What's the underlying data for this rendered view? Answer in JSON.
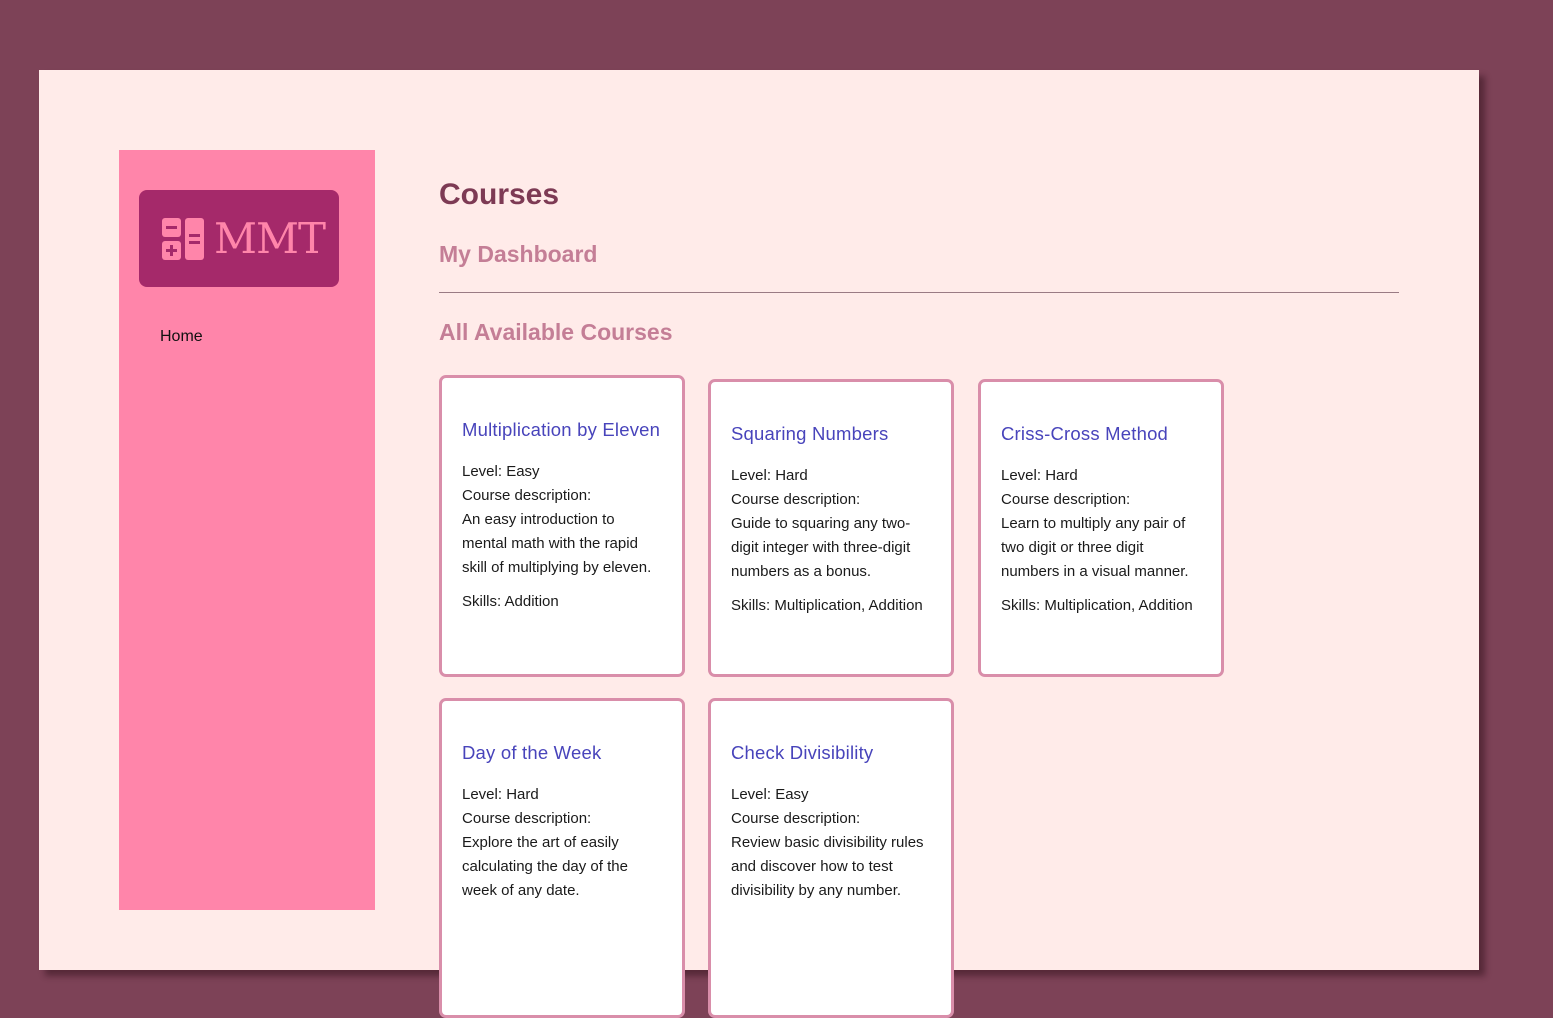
{
  "brand": {
    "logo_text": "MMT",
    "logo_icon": "calculator-icon",
    "colors": {
      "background": "#7d4257",
      "page": "#ffebe9",
      "sidebar": "#ff85aa",
      "logo_bg": "#a5296a",
      "title": "#7d3a54",
      "section": "#c47e96",
      "card_title": "#4844bb",
      "card_border": "#d98eaa"
    }
  },
  "sidebar": {
    "nav": [
      {
        "label": "Home"
      }
    ]
  },
  "main": {
    "title": "Courses",
    "dashboard_heading": "My Dashboard",
    "available_heading": "All Available Courses"
  },
  "courses": [
    {
      "title": "Multiplication by Eleven",
      "level": "Level: Easy",
      "desc_label": "Course description:",
      "description": "An easy introduction to mental math with the rapid skill of multiplying by eleven.",
      "skills": "Skills: Addition"
    },
    {
      "title": "Squaring Numbers",
      "level": "Level: Hard",
      "desc_label": "Course description:",
      "description": "Guide to squaring any two-digit integer with three-digit numbers as a bonus.",
      "skills": "Skills: Multiplication, Addition"
    },
    {
      "title": "Criss-Cross Method",
      "level": "Level: Hard",
      "desc_label": "Course description:",
      "description": "Learn to multiply any pair of two digit or three digit numbers in a visual manner.",
      "skills": "Skills: Multiplication, Addition"
    },
    {
      "title": "Day of the Week",
      "level": "Level: Hard",
      "desc_label": "Course description:",
      "description": "Explore the art of easily calculating the day of the week of any date.",
      "skills": ""
    },
    {
      "title": "Check Divisibility",
      "level": "Level: Easy",
      "desc_label": "Course description:",
      "description": "Review basic divisibility rules and discover how to test divisibility by any number.",
      "skills": ""
    }
  ]
}
